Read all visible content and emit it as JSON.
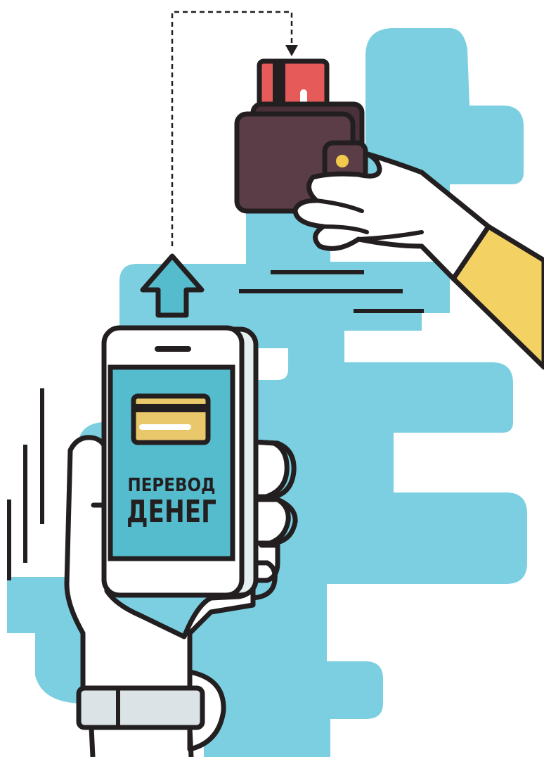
{
  "screen": {
    "line1": "ПЕРЕВОД",
    "line2": "ДЕНЕГ"
  },
  "colors": {
    "outline": "#231f20",
    "background_blob": "#7ccfe0",
    "screen": "#54bccc",
    "wallet": "#5a3d46",
    "card_red": "#e65a5a",
    "card_yellow": "#e8c86a",
    "sleeve": "#f4d163",
    "arrow": "#54bccc",
    "watch_strap": "#dbe3e6",
    "gold_button": "#f2c94c"
  },
  "icons": {
    "wallet": "wallet-icon",
    "credit_card": "credit-card-icon",
    "smartphone": "smartphone-icon",
    "upload_arrow": "arrow-up-icon"
  }
}
